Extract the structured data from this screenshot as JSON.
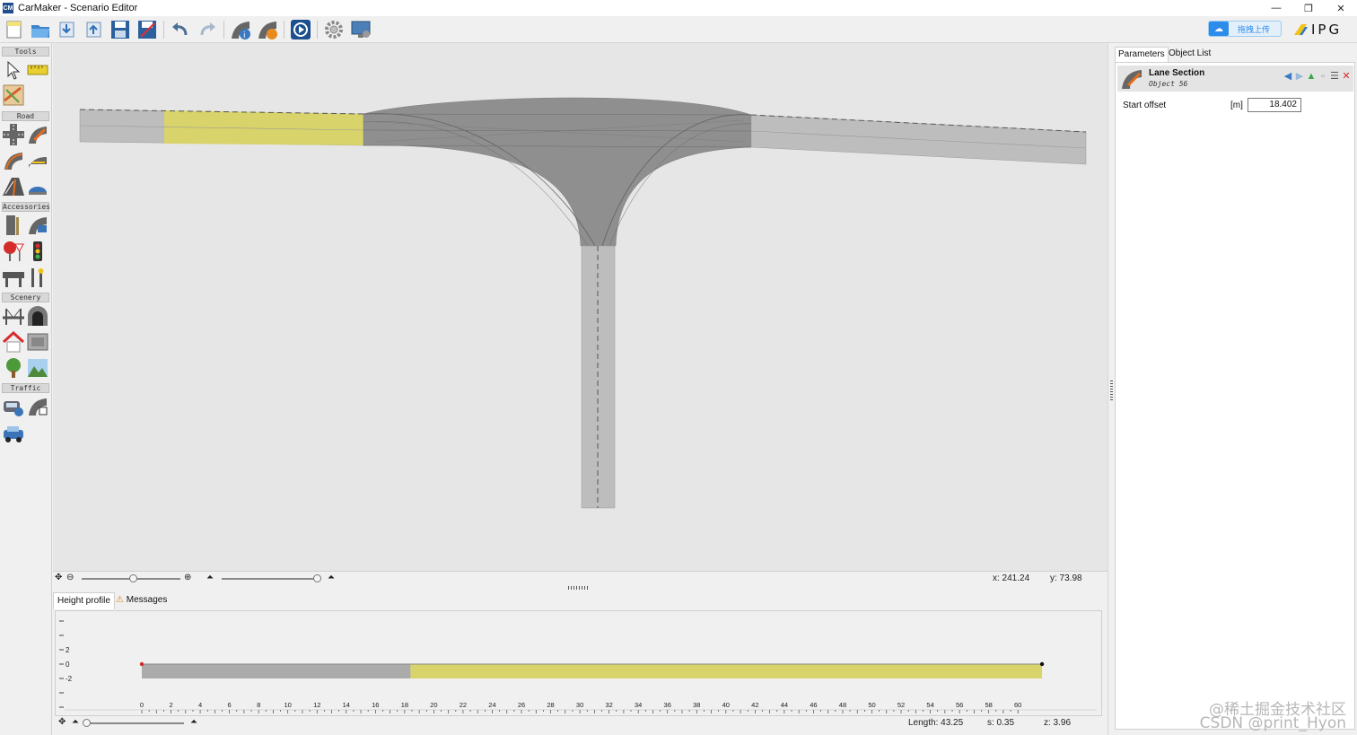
{
  "window": {
    "logo_text": "CM",
    "title": "CarMaker - Scenario Editor",
    "minimize": "—",
    "maximize": "❐",
    "close": "✕"
  },
  "toolbar": {
    "icons": [
      "new-file-icon",
      "open-folder-icon",
      "import-icon",
      "export-icon",
      "save-icon",
      "save-as-icon",
      "undo-icon",
      "redo-icon",
      "road-info-icon",
      "road-check-icon",
      "play-icon",
      "settings-icon",
      "display-icon"
    ],
    "cloud_button": "拖拽上传",
    "brand": "IPG"
  },
  "left_panel": {
    "sections": [
      "Tools",
      "Road",
      "Accessories",
      "Scenery",
      "Traffic"
    ]
  },
  "canvas": {
    "coord_x": "x: 241.24",
    "coord_y": "y: 73.98",
    "zoom_level": 0.52,
    "elevation_level": 1.0
  },
  "bottom": {
    "tab_height_profile": "Height profile",
    "tab_messages": "Messages",
    "y_labels": [
      "2",
      "0",
      "-2"
    ],
    "x_ticks": [
      "0",
      "2",
      "4",
      "6",
      "8",
      "10",
      "12",
      "14",
      "16",
      "18",
      "20",
      "22",
      "24",
      "26",
      "28",
      "30",
      "32",
      "34",
      "36",
      "38",
      "40",
      "42",
      "44",
      "46",
      "48",
      "50",
      "52",
      "54",
      "56",
      "58",
      "60"
    ],
    "length": "Length: 43.25",
    "s": "s: 0.35",
    "z": "z: 3.96",
    "profile_split": 18.402,
    "profile_end": 61.65
  },
  "right_panel": {
    "tab_parameters": "Parameters",
    "tab_object_list": "Object List",
    "object_title": "Lane Section",
    "object_subtitle": "Object 56",
    "param_label": "Start offset",
    "param_unit": "[m]",
    "param_value": "18.402"
  },
  "watermark": {
    "line1": "@稀土掘金技术社区",
    "line2": "CSDN @print_Hyon"
  },
  "colors": {
    "road": "#b9b9b9",
    "junction": "#8f8f8f",
    "selection": "#d8d36a",
    "canvas_bg": "#e6e6e6"
  }
}
